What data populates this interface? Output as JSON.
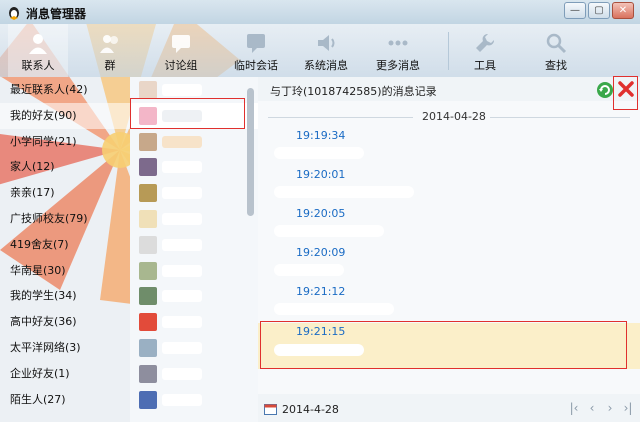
{
  "app": {
    "title": "消息管理器"
  },
  "toolbar": {
    "items": [
      {
        "label": "联系人",
        "icon": "contacts-icon"
      },
      {
        "label": "群",
        "icon": "group-icon"
      },
      {
        "label": "讨论组",
        "icon": "discussion-icon"
      },
      {
        "label": "临时会话",
        "icon": "temp-chat-icon"
      },
      {
        "label": "系统消息",
        "icon": "speaker-icon"
      },
      {
        "label": "更多消息",
        "icon": "more-icon"
      },
      {
        "label": "工具",
        "icon": "wrench-icon"
      },
      {
        "label": "查找",
        "icon": "search-icon"
      }
    ]
  },
  "groups": [
    {
      "label": "最近联系人(42)"
    },
    {
      "label": "我的好友(90)"
    },
    {
      "label": "小学同学(21)"
    },
    {
      "label": "家人(12)"
    },
    {
      "label": "亲亲(17)"
    },
    {
      "label": "广技师校友(79)"
    },
    {
      "label": "419舍友(7)"
    },
    {
      "label": "华南星(30)"
    },
    {
      "label": "我的学生(34)"
    },
    {
      "label": "高中好友(36)"
    },
    {
      "label": "太平洋网络(3)"
    },
    {
      "label": "企业好友(1)"
    },
    {
      "label": "陌生人(27)"
    }
  ],
  "panel": {
    "title": "与丁玲(1018742585)的消息记录",
    "date": "2014-04-28",
    "messages": [
      {
        "time": "19:19:34"
      },
      {
        "time": "19:20:01"
      },
      {
        "time": "19:20:05"
      },
      {
        "time": "19:20:09"
      },
      {
        "time": "19:21:12"
      },
      {
        "time": "19:21:15"
      }
    ],
    "footer_date": "2014-4-28"
  },
  "colors": {
    "time_text": "#1a6bc4",
    "highlight_row": "#fbefc9",
    "annotation_red": "#e0302e"
  }
}
